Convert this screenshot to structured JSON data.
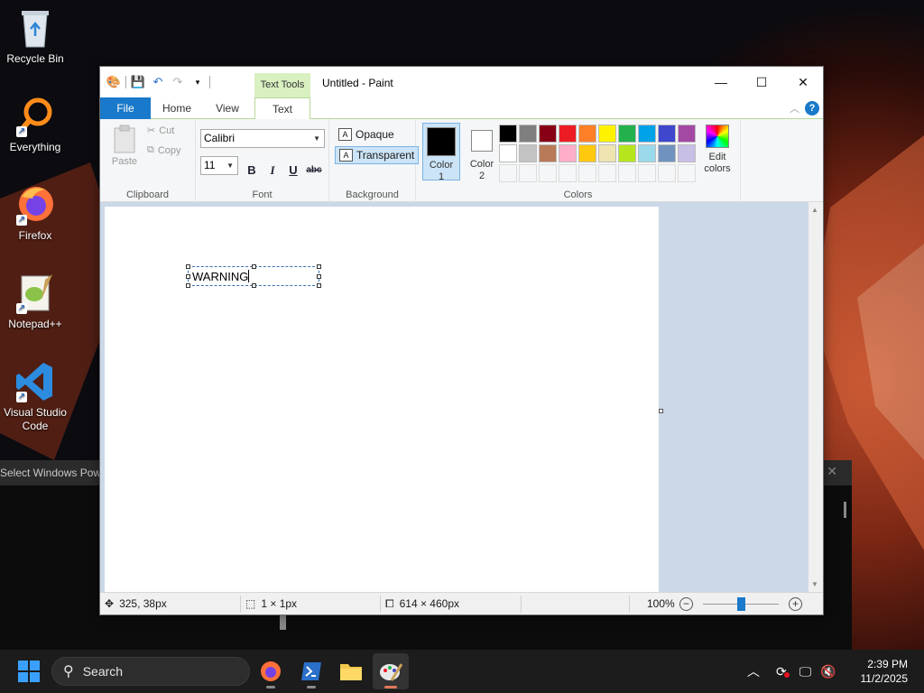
{
  "desktop": {
    "icons": [
      {
        "label": "Recycle Bin"
      },
      {
        "label": "Everything"
      },
      {
        "label": "Firefox"
      },
      {
        "label": "Notepad++"
      },
      {
        "label": "Visual Studio Code"
      }
    ],
    "background_window_title": "Select Windows Powe"
  },
  "paint": {
    "title": "Untitled - Paint",
    "context_tab": "Text Tools",
    "tabs": [
      "File",
      "Home",
      "View",
      "Text"
    ],
    "active_tab": "Text",
    "clipboard": {
      "paste": "Paste",
      "cut": "Cut",
      "copy": "Copy",
      "label": "Clipboard"
    },
    "font": {
      "family": "Calibri",
      "size": "11",
      "label": "Font",
      "bold": "B",
      "italic": "I",
      "underline": "U",
      "strike": "abc"
    },
    "background": {
      "opaque": "Opaque",
      "transparent": "Transparent",
      "label": "Background",
      "selected": "Transparent"
    },
    "colors": {
      "color1_label": "Color 1",
      "color2_label": "Color 2",
      "color1": "#000000",
      "color2": "#ffffff",
      "edit_label": "Edit colors",
      "label": "Colors",
      "palette_row1": [
        "#000000",
        "#7f7f7f",
        "#880015",
        "#ed1c24",
        "#ff7f27",
        "#fff200",
        "#22b14c",
        "#00a2e8",
        "#3f48cc",
        "#a349a4"
      ],
      "palette_row2": [
        "#ffffff",
        "#c3c3c3",
        "#b97a57",
        "#ffaec9",
        "#ffc90e",
        "#efe4b0",
        "#b5e61d",
        "#99d9ea",
        "#7092be",
        "#c8bfe7"
      ]
    },
    "canvas": {
      "text": "WARNING"
    },
    "status": {
      "position": "325, 38px",
      "selection": "1 × 1px",
      "size": "614 × 460px",
      "zoom": "100%"
    }
  },
  "taskbar": {
    "search_placeholder": "Search",
    "time": "2:39 PM",
    "date": "11/2/2025"
  }
}
